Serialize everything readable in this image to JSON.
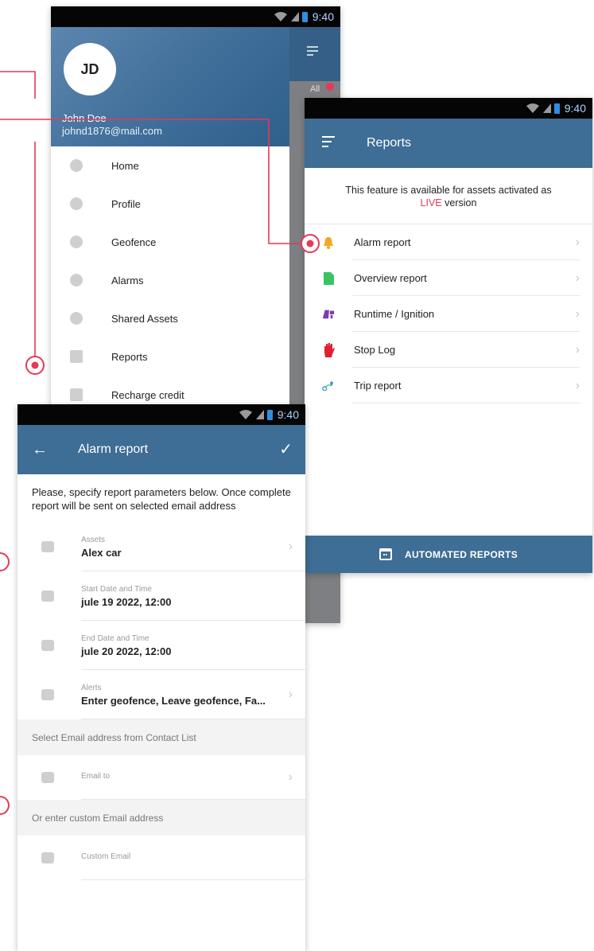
{
  "status": {
    "time": "9:40"
  },
  "drawer": {
    "avatar_initials": "JD",
    "user_name": "John Doe",
    "user_email": "johnd1876@mail.com",
    "tab_label": "All",
    "items": [
      {
        "label": "Home",
        "icon": "home-icon"
      },
      {
        "label": "Profile",
        "icon": "gear-icon"
      },
      {
        "label": "Geofence",
        "icon": "geofence-icon"
      },
      {
        "label": "Alarms",
        "icon": "alarm-icon"
      },
      {
        "label": "Shared Assets",
        "icon": "share-icon"
      },
      {
        "label": "Reports",
        "icon": "bar-chart-icon"
      },
      {
        "label": "Recharge credit",
        "icon": "credit-card-icon"
      }
    ]
  },
  "reports": {
    "title": "Reports",
    "notice_prefix": "This feature is available for assets activated as",
    "notice_live": "LIVE",
    "notice_suffix": " version",
    "items": [
      {
        "label": "Alarm report",
        "icon": "bell-icon",
        "color": "#f5a623"
      },
      {
        "label": "Overview report",
        "icon": "document-icon",
        "color": "#39c464"
      },
      {
        "label": "Runtime / Ignition",
        "icon": "ignition-icon",
        "color": "#7b3bb0"
      },
      {
        "label": "Stop Log",
        "icon": "stop-hand-icon",
        "color": "#e02030"
      },
      {
        "label": "Trip report",
        "icon": "route-icon",
        "color": "#3a8fd8"
      }
    ],
    "automated_label": "AUTOMATED REPORTS"
  },
  "alarm": {
    "title": "Alarm report",
    "description": "Please, specify report parameters below. Once complete report will be sent on selected email address",
    "fields": [
      {
        "label": "Assets",
        "value": "Alex car",
        "icon": "car-icon"
      },
      {
        "label": "Start Date and Time",
        "value": "jule 19 2022, 12:00",
        "icon": "calendar-icon"
      },
      {
        "label": "End Date and Time",
        "value": "jule 20 2022, 12:00",
        "icon": "calendar-icon"
      },
      {
        "label": "Alerts",
        "value": "Enter geofence, Leave geofence, Fa...",
        "icon": "bell-icon"
      }
    ],
    "section_contacts": "Select Email address from Contact List",
    "email_to_label": "Email to",
    "section_custom": "Or enter custom Email address",
    "custom_email_label": "Custom Email"
  },
  "colors": {
    "appbar": "#3e6d95",
    "accent": "#e53957"
  }
}
